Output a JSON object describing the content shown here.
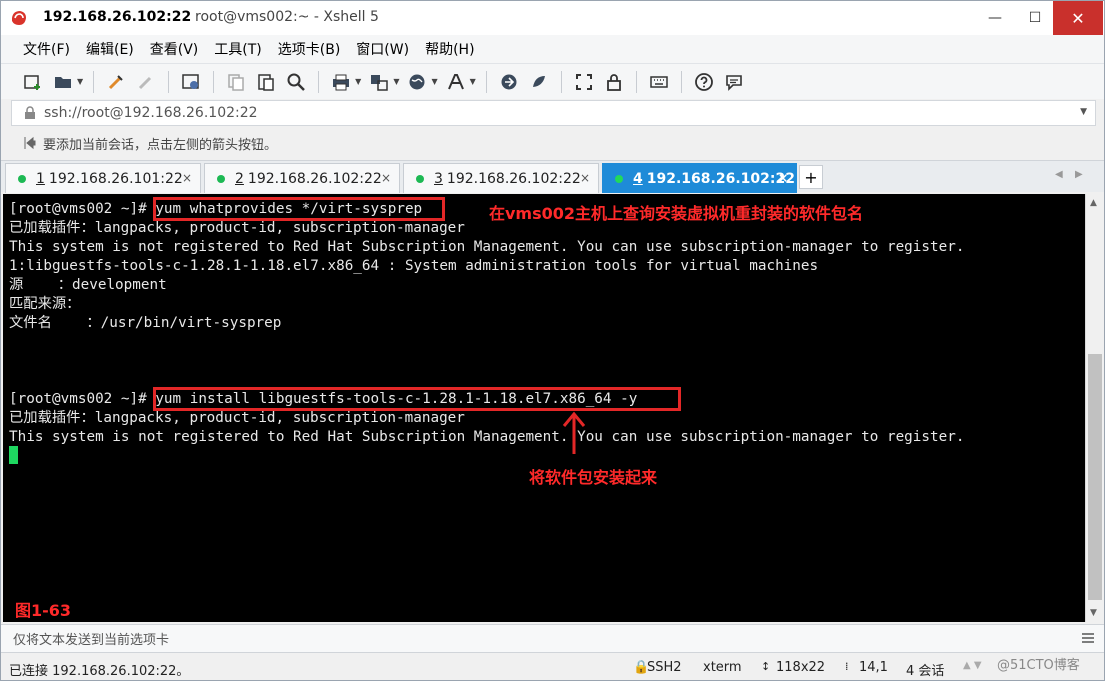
{
  "window": {
    "title_host": "192.168.26.102:22",
    "title_rest": "root@vms002:~ - Xshell 5",
    "min_label": "—",
    "max_label": "☐",
    "close_label": "✕"
  },
  "menu": [
    "文件(F)",
    "编辑(E)",
    "查看(V)",
    "工具(T)",
    "选项卡(B)",
    "窗口(W)",
    "帮助(H)"
  ],
  "address": {
    "value": "ssh://root@192.168.26.102:22",
    "dropdown": "▼"
  },
  "hint": "要添加当前会话，点击左侧的箭头按钮。",
  "tabs": [
    {
      "num": "1",
      "label": "192.168.26.101:22",
      "active": false
    },
    {
      "num": "2",
      "label": "192.168.26.102:22",
      "active": false
    },
    {
      "num": "3",
      "label": "192.168.26.102:22",
      "active": false
    },
    {
      "num": "4",
      "label": "192.168.26.102:22",
      "active": true
    }
  ],
  "tab_close": "×",
  "tab_add": "+",
  "tab_nav": {
    "left": "◀",
    "right": "▶"
  },
  "terminal": {
    "lines": [
      "[root@vms002 ~]# yum whatprovides */virt-sysprep",
      "已加载插件：langpacks, product-id, subscription-manager",
      "This system is not registered to Red Hat Subscription Management. You can use subscription-manager to register.",
      "1:libguestfs-tools-c-1.28.1-1.18.el7.x86_64 : System administration tools for virtual machines",
      "源    ：development",
      "匹配来源：",
      "文件名    ：/usr/bin/virt-sysprep",
      "",
      "",
      "",
      "[root@vms002 ~]# yum install libguestfs-tools-c-1.28.1-1.18.el7.x86_64 -y",
      "已加载插件：langpacks, product-id, subscription-manager",
      "This system is not registered to Red Hat Subscription Management. You can use subscription-manager to register."
    ],
    "annotation_1": "在vms002主机上查询安装虚拟机重封装的软件包名",
    "annotation_2": "将软件包安装起来",
    "figure_label": "图1-63"
  },
  "compose": {
    "placeholder": "仅将文本发送到当前选项卡"
  },
  "status": {
    "connection": "已连接 192.168.26.102:22。",
    "protocol": "SSH2",
    "term": "xterm",
    "size": "118x22",
    "cursor_pos": "14,1",
    "sessions": "4 会话",
    "watermark": "@51CTO博客"
  },
  "colors": {
    "accent_tab": "#1e8bd8",
    "annotation_red": "#e32727",
    "terminal_bg": "#000000",
    "cursor_green": "#1ed760"
  }
}
